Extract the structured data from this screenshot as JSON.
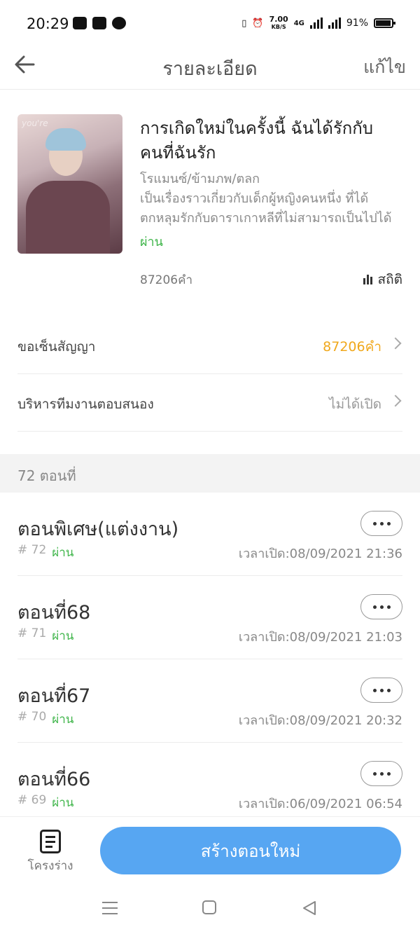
{
  "status_bar": {
    "time": "20:29",
    "speed": "7.00",
    "speed_unit": "KB/S",
    "network": "4G",
    "battery": "91%"
  },
  "header": {
    "title": "รายละเอียด",
    "edit_label": "แก้ไข"
  },
  "book": {
    "cover_text": "you're",
    "title": "การเกิดใหม่ในครั้งนี้ ฉันได้รักกับคนที่ฉันรัก",
    "genre": "โรแมนซ์/ข้ามภพ/ตลก",
    "description": "เป็นเรื่องราวเกี่ยวกับเด็กผู้หญิงคนหนึ่ง ที่ได้ตกหลุมรักกับดาราเกาหลีที่ไม่สามารถเป็นไปได้",
    "status": "ผ่าน",
    "word_count": "87206คำ",
    "stats_label": "สถิติ"
  },
  "settings": [
    {
      "label": "ขอเซ็นสัญญา",
      "value": "87206คำ",
      "value_color": "#f0a81c"
    },
    {
      "label": "บริหารทีมงานตอบสนอง",
      "value": "ไม่ได้เปิด",
      "value_color": "#999999"
    }
  ],
  "chapters_header": "72 ตอนที่",
  "chapters": [
    {
      "title": "ตอนพิเศษ(แต่งงาน)",
      "number": "# 72",
      "status": "ผ่าน",
      "time": "เวลาเปิด:08/09/2021 21:36"
    },
    {
      "title": "ตอนที่68",
      "number": "# 71",
      "status": "ผ่าน",
      "time": "เวลาเปิด:08/09/2021 21:03"
    },
    {
      "title": "ตอนที่67",
      "number": "# 70",
      "status": "ผ่าน",
      "time": "เวลาเปิด:08/09/2021 20:32"
    },
    {
      "title": "ตอนที่66",
      "number": "# 69",
      "status": "ผ่าน",
      "time": "เวลาเปิด:06/09/2021 06:54"
    }
  ],
  "bottom_bar": {
    "draft_label": "โครงร่าง",
    "create_label": "สร้างตอนใหม่"
  },
  "colors": {
    "accent_blue": "#57a6f2",
    "status_green": "#3fb54a",
    "contract_orange": "#f0a81c"
  },
  "icons": [
    "back-arrow-icon",
    "stats-bars-icon",
    "chevron-right-icon",
    "more-dots-icon",
    "draft-document-icon",
    "nav-menu-icon",
    "nav-home-icon",
    "nav-back-icon"
  ]
}
